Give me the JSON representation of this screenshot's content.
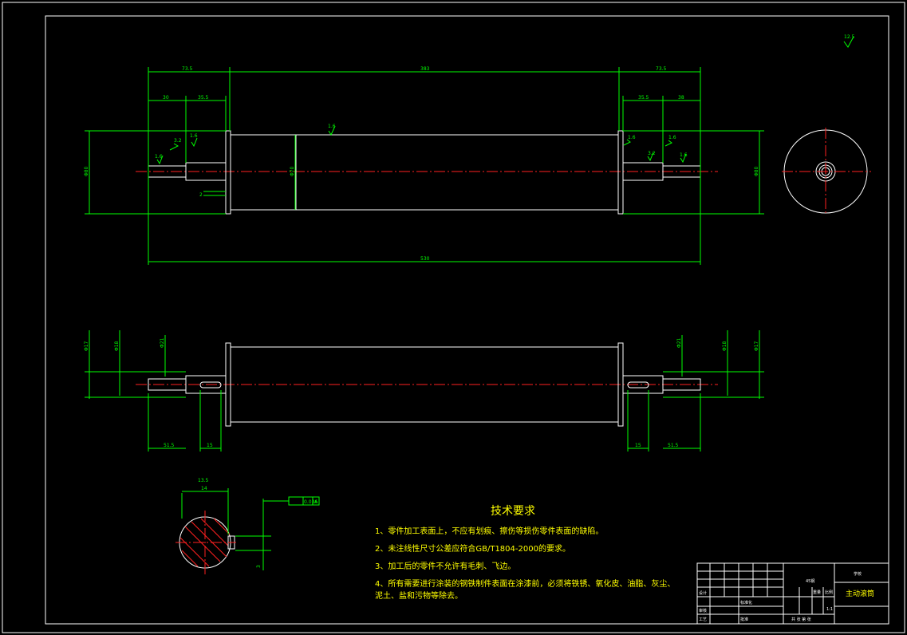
{
  "drawing": {
    "roughness_symbol": "12.5",
    "dims_top": {
      "left_total": "73.5",
      "center": "383",
      "right_total": "73.5",
      "left_a": "30",
      "left_b": "35.5",
      "right_a": "35.5",
      "right_b": "38",
      "overall": "530",
      "dia_left": "Φ80",
      "dia_center": "Φ70",
      "dia_right": "Φ80",
      "gap": "2"
    },
    "roughness_marks": [
      "1.6",
      "1.6",
      "3.2",
      "1.6",
      "1.6",
      "3.2",
      "1.6",
      "1.6"
    ],
    "dims_bottom": {
      "left_len": "51.5",
      "left_key": "15",
      "right_key": "15",
      "right_len": "51.5",
      "dia_left_a": "Φ17",
      "dia_left_b": "Φ18",
      "dia_left_c": "Φ21",
      "dia_right_a": "Φ17",
      "dia_right_b": "Φ18",
      "dia_right_c": "Φ21"
    },
    "section": {
      "width_dim": "14",
      "key_dim": "13.5",
      "tolerance": "0.036",
      "datum": "A",
      "small_dim": "3"
    }
  },
  "requirements": {
    "title": "技术要求",
    "items": [
      "1、零件加工表面上，不应有划痕、擦伤等损伤零件表面的缺陷。",
      "2、未注线性尺寸公差应符合GB/T1804-2000的要求。",
      "3、加工后的零件不允许有毛刺、飞边。",
      "4、所有需要进行涂装的钢铁制件表面在涂漆前，必须将铁锈、氧化皮、油脂、灰尘、",
      "泥土、盐和污物等除去。"
    ]
  },
  "title_block": {
    "material": "45钢",
    "school": "学校",
    "part_name": "主动滚筒",
    "scale": "比例",
    "scale_value": "1:1",
    "sheets": "共 张 第 张",
    "designer": "设计",
    "reviewer": "审核",
    "process": "工艺",
    "approve": "批准",
    "standard": "标准化",
    "weight": "重量"
  }
}
